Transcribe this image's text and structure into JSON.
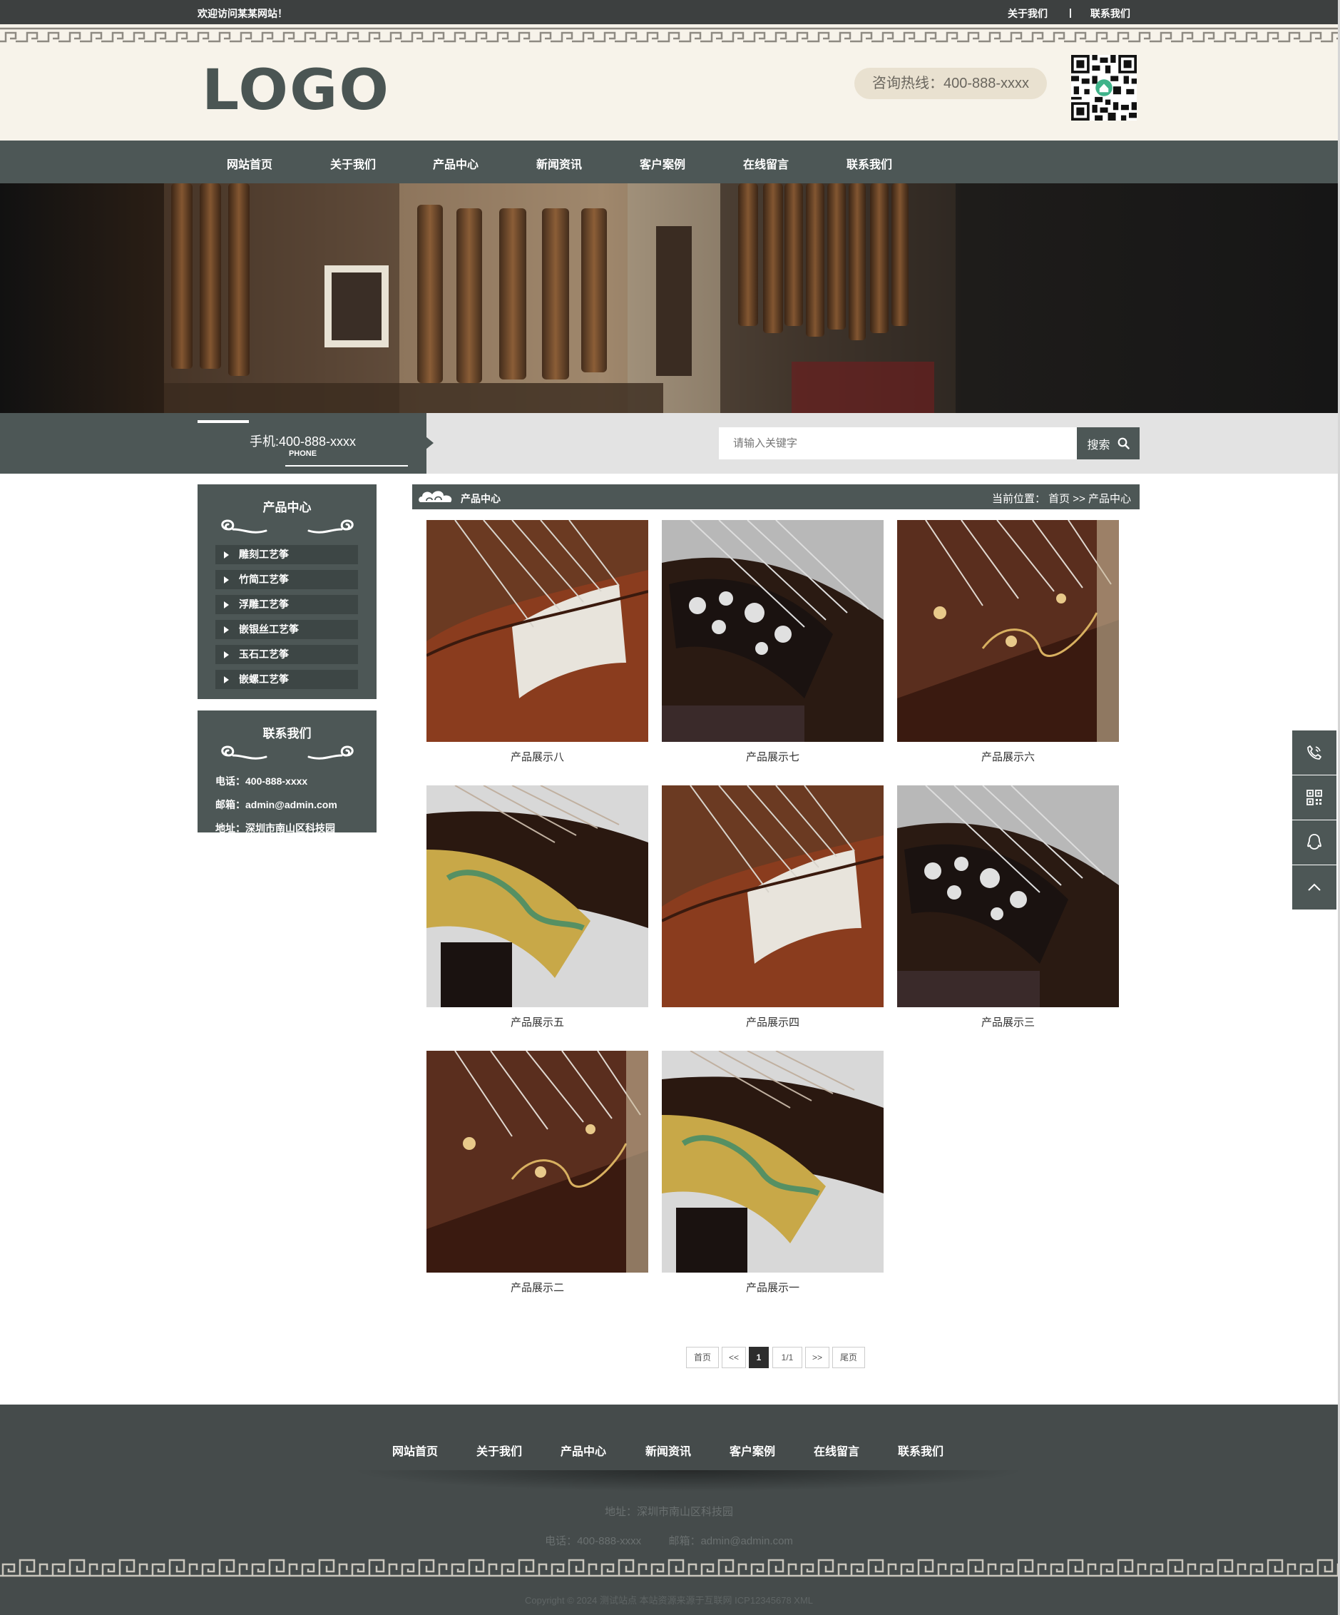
{
  "topbar": {
    "welcome": "欢迎访问某某网站！",
    "about": "关于我们",
    "separator": "|",
    "contact": "联系我们"
  },
  "header": {
    "logo": "LOGO",
    "hotline": "咨询热线：400-888-xxxx",
    "qr_icon": "qr-code-icon"
  },
  "nav": {
    "items": [
      "网站首页",
      "关于我们",
      "产品中心",
      "新闻资讯",
      "客户案例",
      "在线留言",
      "联系我们"
    ]
  },
  "strip": {
    "phone": "手机:400-888-xxxx",
    "phone_sub": "PHONE",
    "search_placeholder": "请输入关键字",
    "search_button": "搜索"
  },
  "sidebar": {
    "products_title": "产品中心",
    "categories": [
      "雕刻工艺筝",
      "竹简工艺筝",
      "浮雕工艺筝",
      "嵌银丝工艺筝",
      "玉石工艺筝",
      "嵌螺工艺筝"
    ],
    "contact_title": "联系我们",
    "contact_lines": [
      "电话：400-888-xxxx",
      "邮箱：admin@admin.com",
      "地址：深圳市南山区科技园"
    ]
  },
  "main": {
    "title": "产品中心",
    "breadcrumb": "当前位置： 首页 >> 产品中心",
    "products": [
      "产品展示八",
      "产品展示七",
      "产品展示六",
      "产品展示五",
      "产品展示四",
      "产品展示三",
      "产品展示二",
      "产品展示一"
    ]
  },
  "pagination": {
    "first": "首页",
    "prev": "<<",
    "current": "1",
    "total": "1/1",
    "next": ">>",
    "last": "尾页"
  },
  "footer": {
    "nav": [
      "网站首页",
      "关于我们",
      "产品中心",
      "新闻资讯",
      "客户案例",
      "在线留言",
      "联系我们"
    ],
    "address": "地址：深圳市南山区科技园",
    "phone": "电话：400-888-xxxx",
    "email": "邮箱：admin@admin.com",
    "copyright": "Copyright © 2024 测试站点 本站资源来源于互联网 ICP12345678 XML"
  },
  "colors": {
    "primary": "#4d5756",
    "topbar": "#3d4040",
    "header_bg": "#f7f3ea",
    "footer_bg": "#454b4b"
  }
}
